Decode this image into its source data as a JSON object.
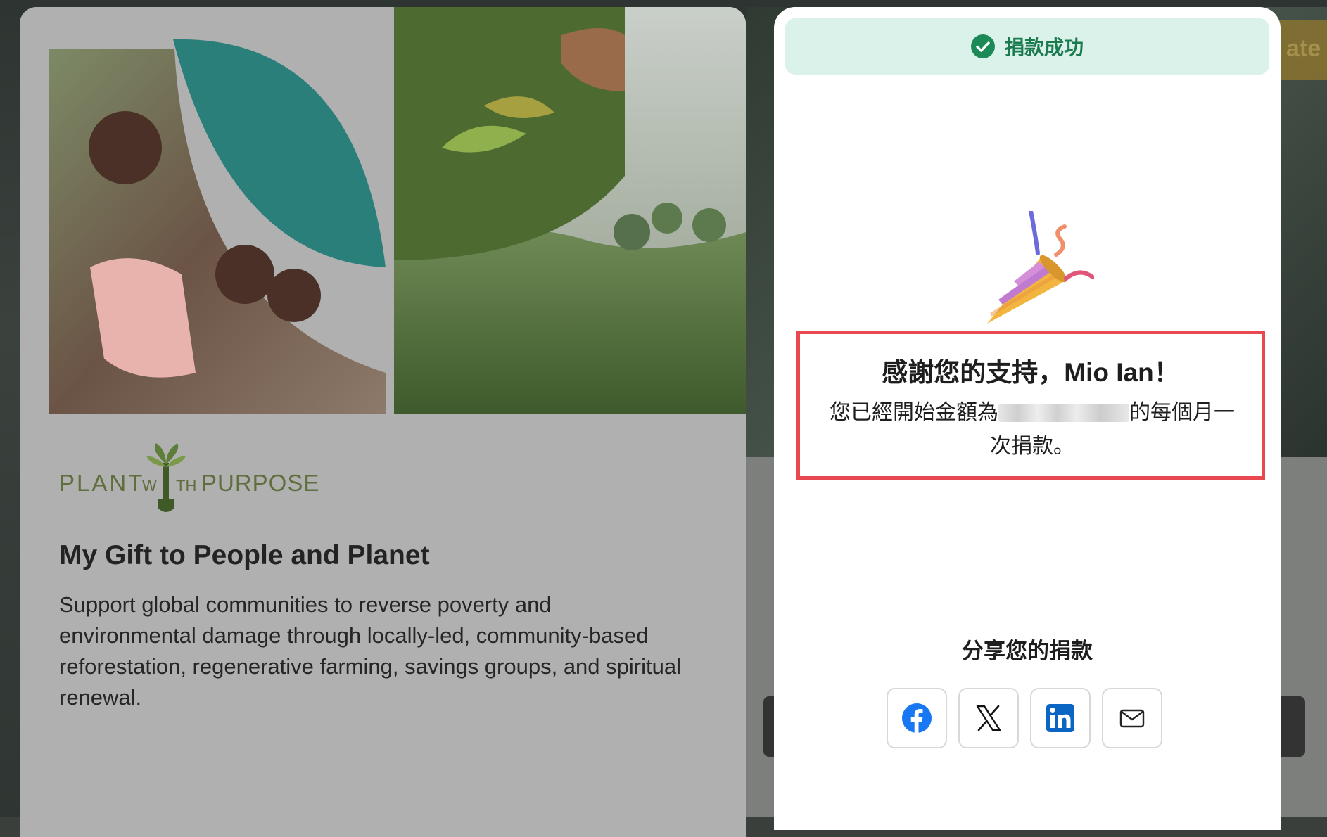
{
  "background": {
    "cta_fragment": "ate"
  },
  "campaign": {
    "logo_text": "PLANT WITH PURPOSE",
    "title": "My Gift to People and Planet",
    "description": "Support global communities to reverse poverty and environmental damage through locally-led, community-based reforestation, regenerative farming, savings groups, and spiritual renewal."
  },
  "modal": {
    "toast": "捐款成功",
    "thanks_title": "感謝您的支持，Mio Ian！",
    "thanks_body_prefix": "您已經開始金額為",
    "thanks_body_suffix": "的每個月一次捐款。",
    "share_label": "分享您的捐款",
    "share_buttons": [
      "facebook",
      "x",
      "linkedin",
      "email"
    ]
  },
  "colors": {
    "toast_bg": "#dbf2ea",
    "toast_text": "#1b7a4e",
    "highlight_border": "#e8484f",
    "facebook": "#1877f2",
    "linkedin": "#0a66c2"
  }
}
